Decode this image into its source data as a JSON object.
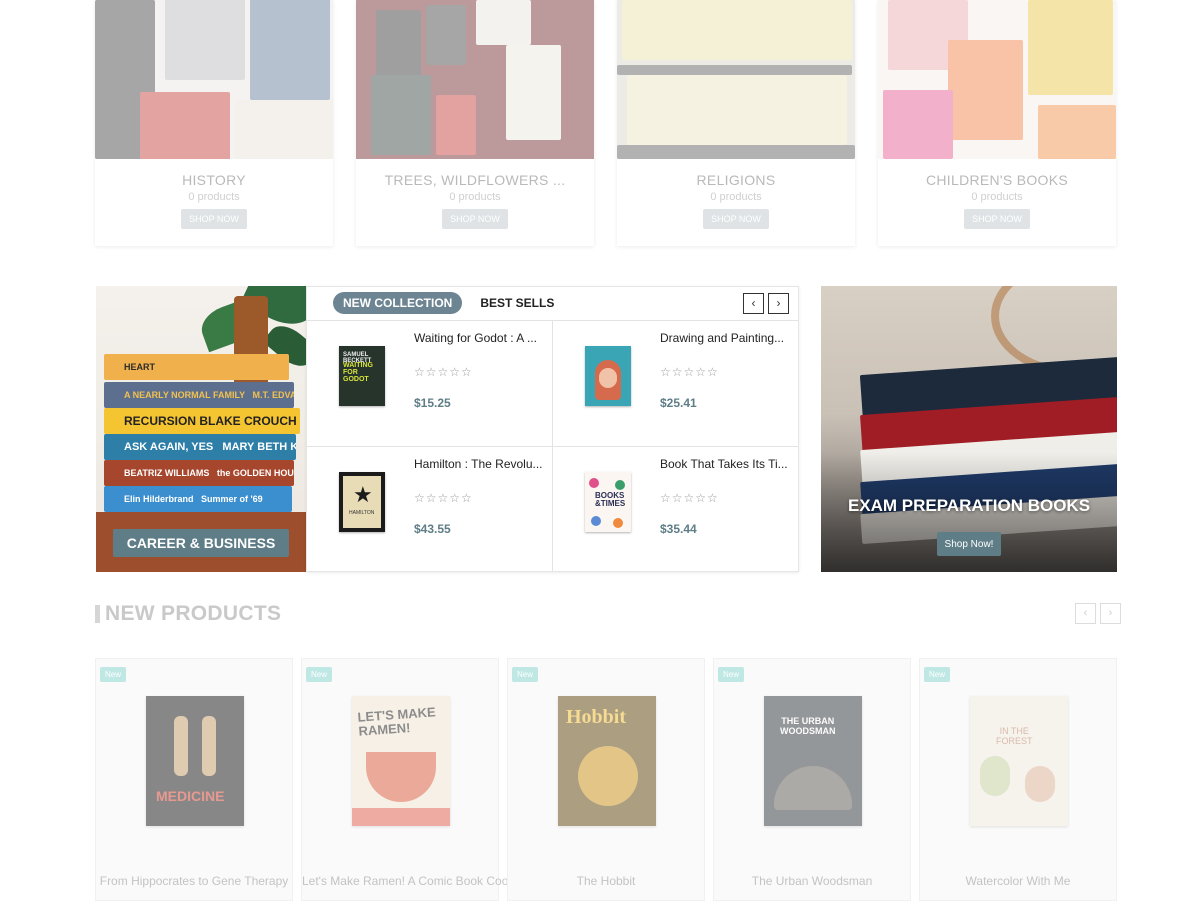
{
  "categories": [
    {
      "name": "HISTORY",
      "count": "0 products",
      "button": "SHOP NOW"
    },
    {
      "name": "TREES, WILDFLOWERS ...",
      "count": "0 products",
      "button": "SHOP NOW"
    },
    {
      "name": "RELIGIONS",
      "count": "0 products",
      "button": "SHOP NOW"
    },
    {
      "name": "CHILDREN'S BOOKS",
      "count": "0 products",
      "button": "SHOP NOW"
    }
  ],
  "promo_left": {
    "label": "CAREER & BUSINESS"
  },
  "product_tabs": {
    "tabs": [
      "NEW COLLECTION",
      "BEST SELLS"
    ],
    "prev_icon": "chevron-left-icon",
    "next_icon": "chevron-right-icon",
    "items": [
      {
        "title": "Waiting for Godot : A ...",
        "rating": "☆☆☆☆☆",
        "price": "$15.25"
      },
      {
        "title": "Drawing and Painting...",
        "rating": "☆☆☆☆☆",
        "price": "$25.41"
      },
      {
        "title": "Hamilton : The Revolu...",
        "rating": "☆☆☆☆☆",
        "price": "$43.55"
      },
      {
        "title": "Book That Takes Its Ti...",
        "rating": "☆☆☆☆☆",
        "price": "$35.44"
      }
    ]
  },
  "promo_right": {
    "title": "EXAM PREPARATION BOOKS",
    "button": "Shop Now!"
  },
  "new_products": {
    "title": "NEW PRODUCTS",
    "items": [
      {
        "badge": "New",
        "name": "From Hippocrates to Gene Therapy"
      },
      {
        "badge": "New",
        "name": "Let's Make Ramen! A Comic Book Cook..."
      },
      {
        "badge": "New",
        "name": "The Hobbit"
      },
      {
        "badge": "New",
        "name": "The Urban Woodsman"
      },
      {
        "badge": "New",
        "name": "Watercolor With Me"
      }
    ]
  },
  "colors": {
    "accent": "#5e7d87",
    "tab_active": "#6d8592",
    "badge": "#bfe8e4"
  }
}
